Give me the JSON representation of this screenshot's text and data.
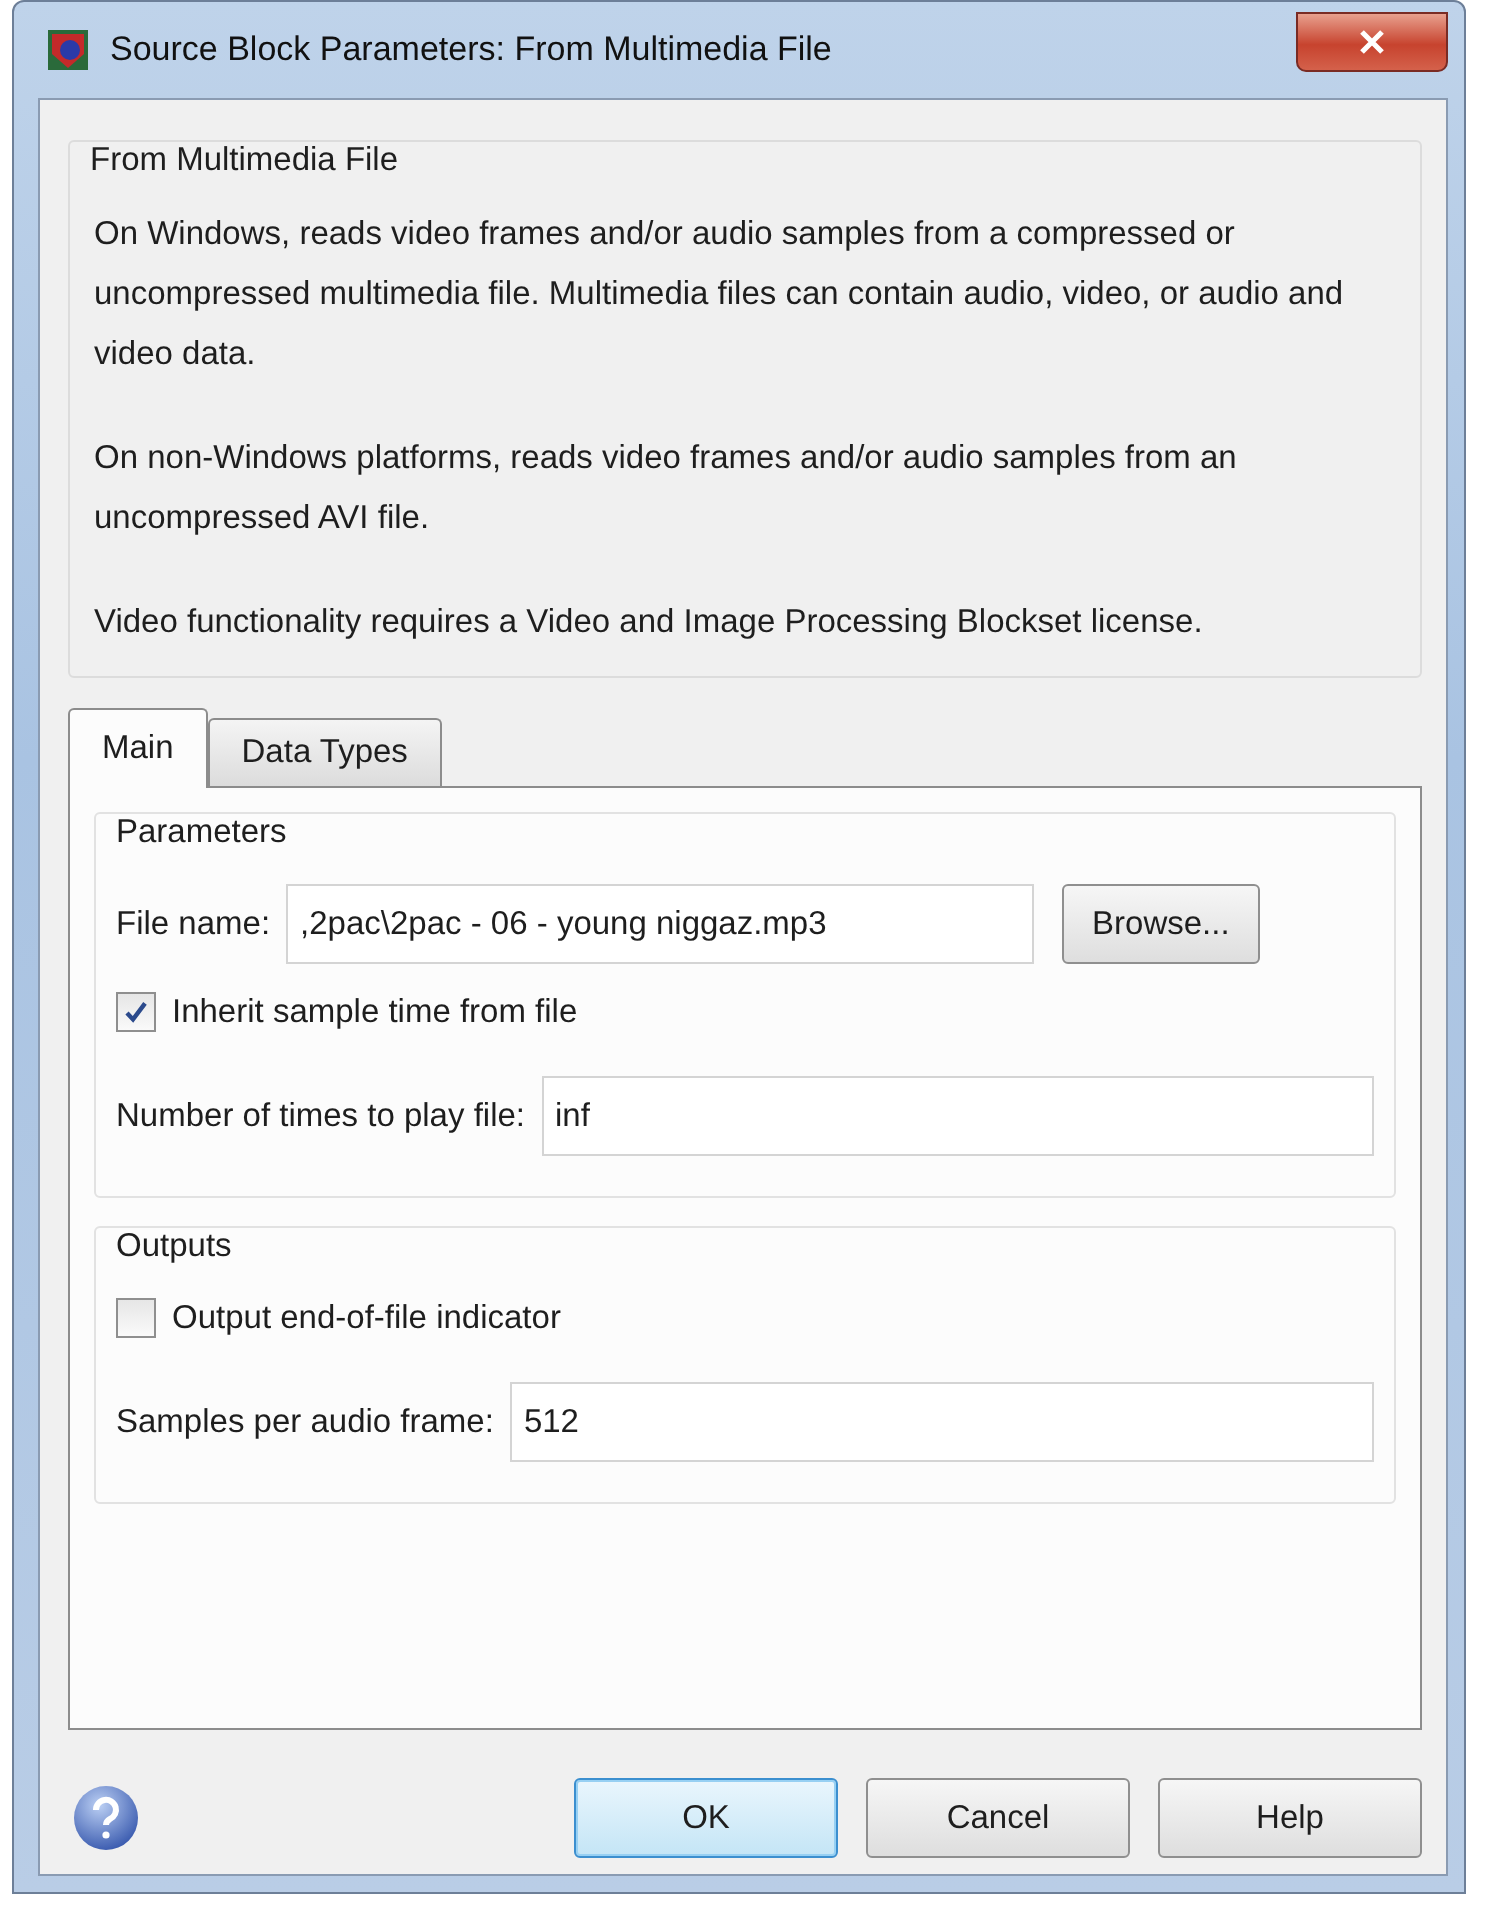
{
  "window": {
    "title": "Source Block Parameters: From Multimedia File"
  },
  "description": {
    "title": "From Multimedia File",
    "paragraphs": [
      "On Windows, reads video frames and/or audio samples from a compressed or uncompressed multimedia file. Multimedia files can contain audio, video, or audio and video data.",
      "On non-Windows platforms, reads video frames and/or audio samples from an uncompressed AVI file.",
      "Video functionality requires a Video and Image Processing Blockset license."
    ]
  },
  "tabs": [
    {
      "label": "Main",
      "selected": true
    },
    {
      "label": "Data Types",
      "selected": false
    }
  ],
  "groups": [
    {
      "title": "Parameters",
      "rows": [
        {
          "kind": "file",
          "label": "File name:",
          "value": ",2pac\\2pac - 06 - young niggaz.mp3",
          "button": "Browse..."
        },
        {
          "kind": "checkbox",
          "label": "Inherit sample time from file",
          "checked": true
        },
        {
          "kind": "field",
          "label": "Number of times to play file:",
          "value": "inf"
        }
      ]
    },
    {
      "title": "Outputs",
      "rows": [
        {
          "kind": "checkbox",
          "label": "Output end-of-file indicator",
          "checked": false
        },
        {
          "kind": "field",
          "label": "Samples per audio frame:",
          "value": "512"
        }
      ]
    }
  ],
  "buttons": [
    {
      "label": "OK",
      "default": true
    },
    {
      "label": "Cancel",
      "default": false
    },
    {
      "label": "Help",
      "default": false
    }
  ]
}
